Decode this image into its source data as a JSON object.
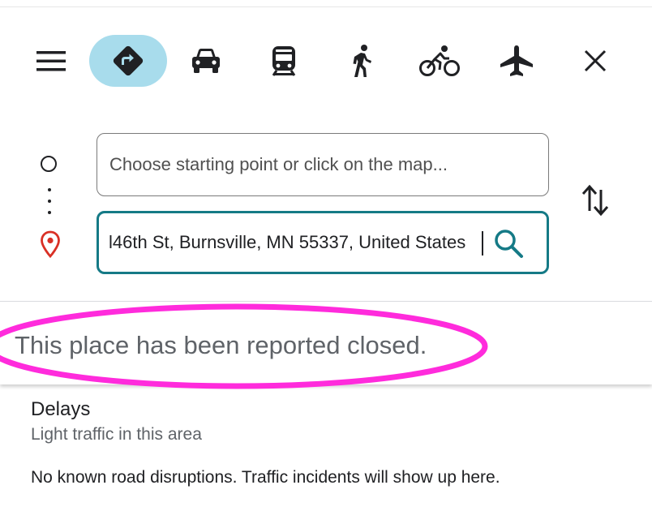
{
  "colors": {
    "active_mode_bg": "#a8dcec",
    "focus_border": "#157a86",
    "search_icon": "#157a86",
    "pin_red": "#d93025",
    "annotation_magenta": "#ff2bdc"
  },
  "toolbar": {
    "menu_icon": "hamburger-menu-icon",
    "modes": [
      {
        "id": "best",
        "icon": "directions-diamond-icon",
        "active": true
      },
      {
        "id": "driving",
        "icon": "car-icon",
        "active": false
      },
      {
        "id": "transit",
        "icon": "train-icon",
        "active": false
      },
      {
        "id": "walking",
        "icon": "walking-person-icon",
        "active": false
      },
      {
        "id": "cycling",
        "icon": "bicycle-icon",
        "active": false
      },
      {
        "id": "flights",
        "icon": "airplane-icon",
        "active": false
      }
    ],
    "close_icon": "close-icon"
  },
  "route": {
    "start_placeholder": "Choose starting point or click on the map...",
    "start_value": "",
    "destination_value": "l46th St, Burnsville, MN 55337, United States",
    "search_icon": "search-icon",
    "swap_icon": "swap-vertical-arrows-icon"
  },
  "notice": {
    "text": "This place has been reported closed."
  },
  "delays": {
    "title": "Delays",
    "subtitle": "Light traffic in this area",
    "body": "No known road disruptions. Traffic incidents will show up here."
  }
}
